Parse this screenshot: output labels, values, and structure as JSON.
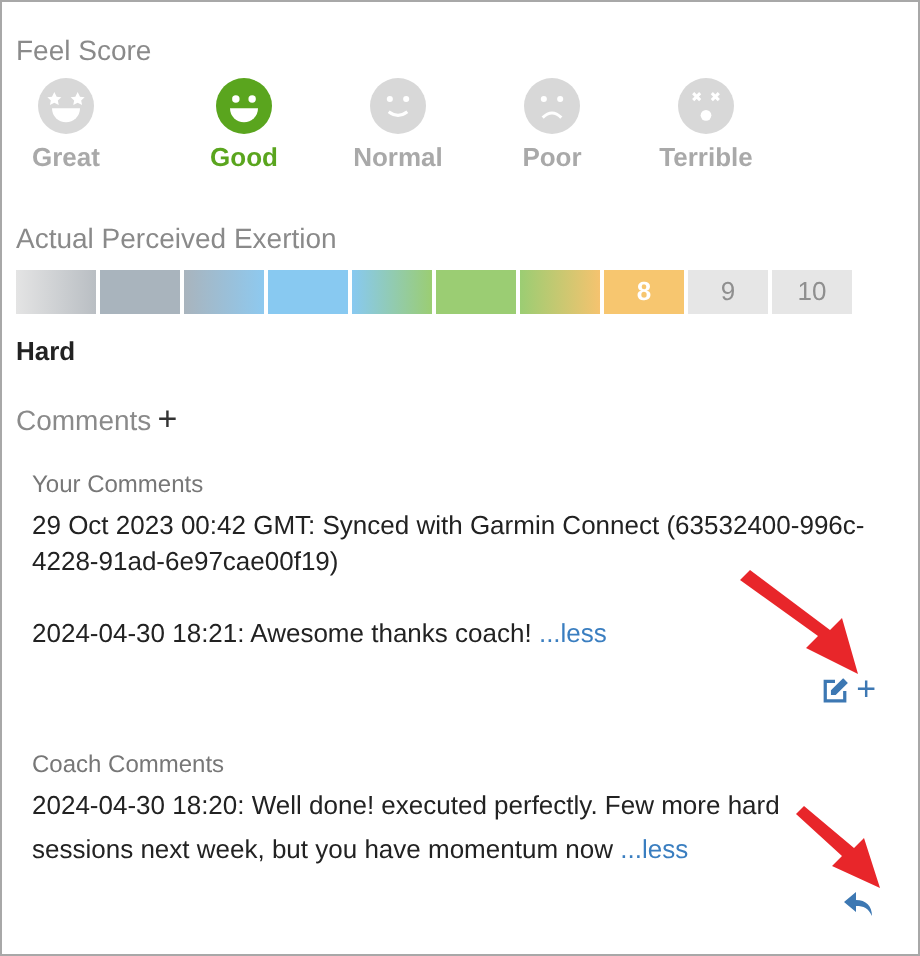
{
  "feel_score": {
    "title": "Feel Score",
    "options": [
      {
        "label": "Great",
        "kind": "stars",
        "selected": false
      },
      {
        "label": "Good",
        "kind": "grin",
        "selected": true
      },
      {
        "label": "Normal",
        "kind": "smile",
        "selected": false
      },
      {
        "label": "Poor",
        "kind": "frown",
        "selected": false
      },
      {
        "label": "Terrible",
        "kind": "dizzy",
        "selected": false
      }
    ]
  },
  "exertion": {
    "title": "Actual Perceived Exertion",
    "segments": [
      {
        "kind": "blend",
        "color": "#b9bec3"
      },
      {
        "kind": "solid",
        "color": "#a9b4bd"
      },
      {
        "kind": "blend",
        "color": "#8ec9ef"
      },
      {
        "kind": "solid",
        "color": "#88c9f1"
      },
      {
        "kind": "blend",
        "color": "#9bcd73"
      },
      {
        "kind": "solid",
        "color": "#9bcd73"
      },
      {
        "kind": "blend",
        "color": "#f5c36f"
      },
      {
        "kind": "solid",
        "color": "#f7c66f",
        "label": "8"
      },
      {
        "kind": "empty",
        "color": "#e6e6e6",
        "label": "9"
      },
      {
        "kind": "empty",
        "color": "#e6e6e6",
        "label": "10"
      }
    ],
    "rating": "Hard"
  },
  "comments": {
    "title": "Comments",
    "add": "+",
    "your_comments": {
      "title": "Your Comments",
      "paragraphs": [
        "29 Oct 2023 00:42 GMT: Synced with Garmin Connect (63532400-996c-4228-91ad-6e97cae00f19)",
        "2024-04-30 18:21: Awesome thanks coach!"
      ],
      "less": "...less",
      "add": "+"
    },
    "coach_comments": {
      "title": "Coach Comments",
      "paragraphs": [
        "2024-04-30 18:20: Well done! executed perfectly. Few more hard sessions next week, but you have momentum now"
      ],
      "less": "...less"
    }
  }
}
